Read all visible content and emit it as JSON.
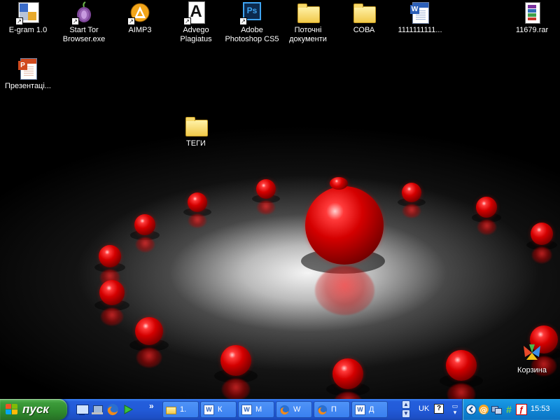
{
  "desktop": {
    "icons": [
      {
        "label": "E-gram 1.0",
        "icon": "e-gram-app-icon"
      },
      {
        "label": "Start Tor\nBrowser.exe",
        "icon": "tor-onion-icon"
      },
      {
        "label": "AIMP3",
        "icon": "aimp-icon"
      },
      {
        "label": "Advego\nPlagiatus",
        "icon": "advego-a-icon"
      },
      {
        "label": "Adobe\nPhotoshop CS5",
        "icon": "photoshop-icon"
      },
      {
        "label": "Поточні\nдокументи",
        "icon": "folder-icon"
      },
      {
        "label": "СОВА",
        "icon": "folder-icon"
      },
      {
        "label": "1111111111...",
        "icon": "word-document-icon"
      },
      {
        "label": "11679.rar",
        "icon": "winrar-archive-icon"
      },
      {
        "label": "Презентаці...",
        "icon": "powerpoint-document-icon"
      },
      {
        "label": "ТЕГИ",
        "icon": "folder-icon"
      },
      {
        "label": "Корзина",
        "icon": "recycle-bin-icon"
      }
    ]
  },
  "taskbar": {
    "start_label": "пуск",
    "quick_launch": [
      "show-desktop-icon",
      "network-icon",
      "firefox-icon",
      "media-play-icon"
    ],
    "overflow_label": "»",
    "buttons": [
      {
        "label": "1.",
        "icon": "folder-icon"
      },
      {
        "label": "К",
        "icon": "word-icon"
      },
      {
        "label": "М",
        "icon": "word-icon"
      },
      {
        "label": "W",
        "icon": "firefox-icon"
      },
      {
        "label": "П",
        "icon": "firefox-icon"
      },
      {
        "label": "Д",
        "icon": "word-icon"
      }
    ],
    "language": "UK",
    "clock": "15:53"
  },
  "colors": {
    "taskbar_blue": "#245edc",
    "start_green": "#3c9b3a",
    "tray_blue": "#0f86d6",
    "sphere_red": "#d40000"
  }
}
